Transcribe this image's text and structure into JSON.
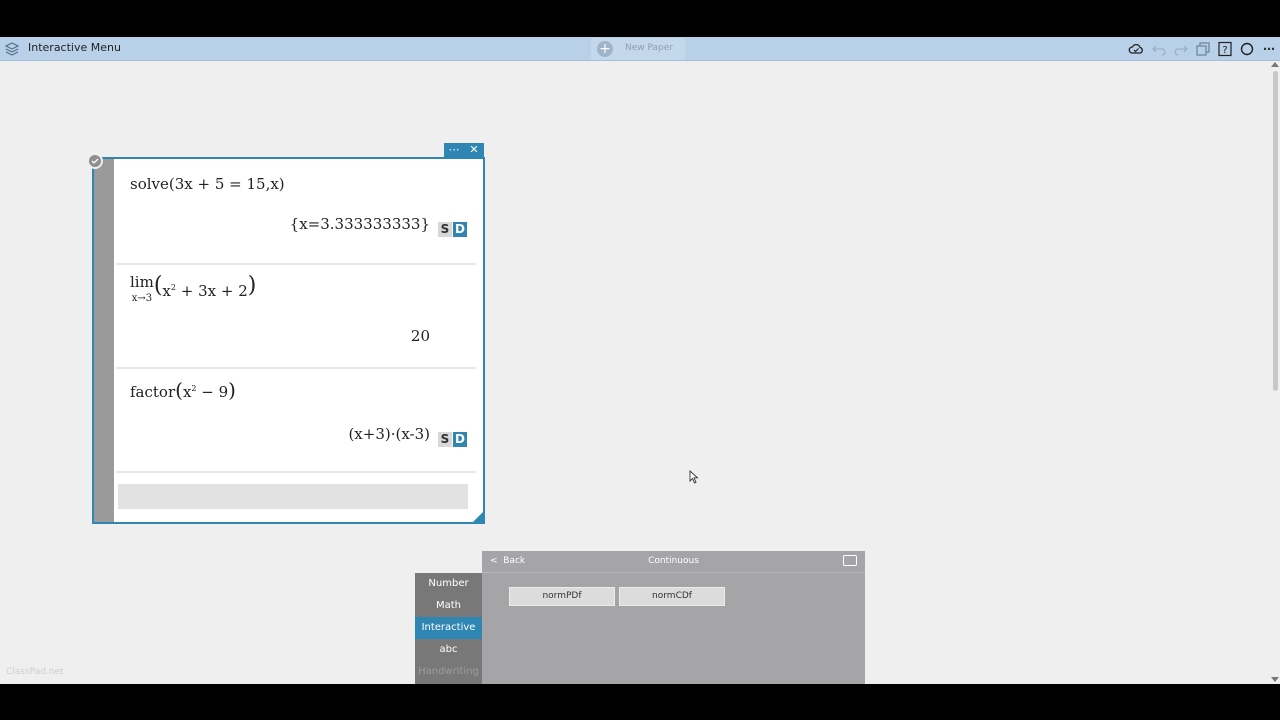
{
  "topbar": {
    "title": "Interactive Menu",
    "new_paper_label": "New Paper"
  },
  "math_window": {
    "menu_icon": "⋯",
    "close_icon": "✕",
    "entries": [
      {
        "result": "{x=3.333333333}",
        "s_label": "S",
        "d_label": "D"
      },
      {
        "result": "20"
      },
      {
        "result": "(x+3)·(x-3)",
        "s_label": "S",
        "d_label": "D"
      }
    ]
  },
  "keyboard": {
    "tabs": [
      "Number",
      "Math",
      "Interactive",
      "abc",
      "Handwriting"
    ],
    "active_tab": "Interactive",
    "back_label": "Back",
    "title": "Continuous",
    "keys": [
      "normPDf",
      "normCDf"
    ]
  },
  "watermark": "ClassPad.net"
}
